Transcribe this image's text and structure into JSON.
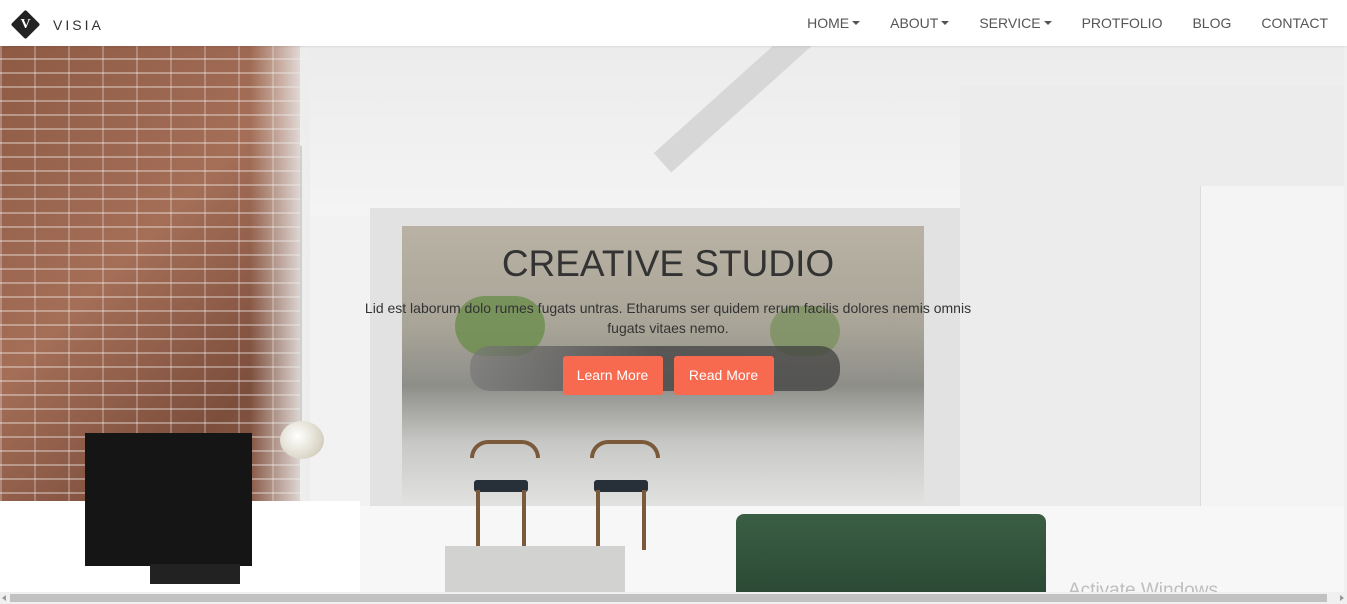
{
  "brand": {
    "logo_letter": "V",
    "name": "VISIA"
  },
  "nav": [
    {
      "label": "HOME",
      "dropdown": true
    },
    {
      "label": "ABOUT",
      "dropdown": true
    },
    {
      "label": "SERVICE",
      "dropdown": true
    },
    {
      "label": "PROTFOLIO",
      "dropdown": false
    },
    {
      "label": "BLOG",
      "dropdown": false
    },
    {
      "label": "CONTACT",
      "dropdown": false
    }
  ],
  "hero": {
    "title": "CREATIVE STUDIO",
    "subtitle": "Lid est laborum dolo rumes fugats untras. Etharums ser quidem rerum facilis dolores nemis omnis fugats vitaes nemo.",
    "learn_more": "Learn More",
    "read_more": "Read More"
  },
  "watermark": "Activate Windows",
  "colors": {
    "accent": "#f86a4f",
    "nav_text": "#555555"
  }
}
